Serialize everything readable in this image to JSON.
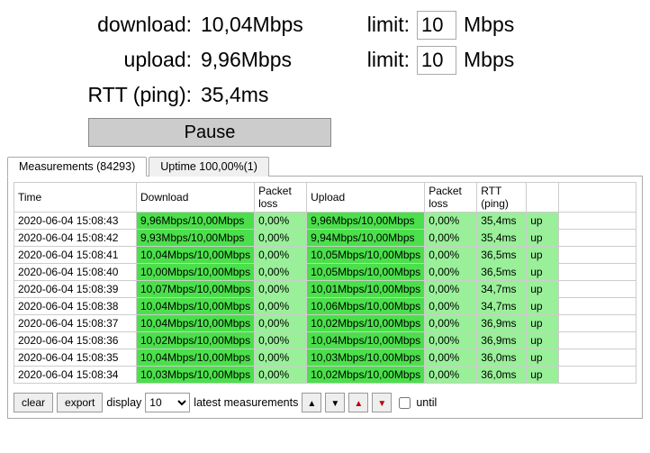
{
  "stats": {
    "download_label": "download:",
    "download_value": "10,04Mbps",
    "upload_label": "upload:",
    "upload_value": "9,96Mbps",
    "rtt_label": "RTT (ping):",
    "rtt_value": "35,4ms",
    "limit_label": "limit:",
    "limit_download_value": "10",
    "limit_upload_value": "10",
    "limit_unit": "Mbps"
  },
  "pause_label": "Pause",
  "tabs": {
    "measurements": "Measurements  (84293)",
    "uptime": "Uptime  100,00%(1)"
  },
  "columns": {
    "time": "Time",
    "download": "Download",
    "packet_loss": "Packet loss",
    "upload": "Upload",
    "packet_loss2": "Packet loss",
    "rtt": "RTT (ping)",
    "status": ""
  },
  "rows": [
    {
      "time": "2020-06-04 15:08:43",
      "dl": "9,96Mbps/10,00Mbps",
      "pl": "0,00%",
      "ul": "9,96Mbps/10,00Mbps",
      "pl2": "0,00%",
      "rtt": "35,4ms",
      "st": "up"
    },
    {
      "time": "2020-06-04 15:08:42",
      "dl": "9,93Mbps/10,00Mbps",
      "pl": "0,00%",
      "ul": "9,94Mbps/10,00Mbps",
      "pl2": "0,00%",
      "rtt": "35,4ms",
      "st": "up"
    },
    {
      "time": "2020-06-04 15:08:41",
      "dl": "10,04Mbps/10,00Mbps",
      "pl": "0,00%",
      "ul": "10,05Mbps/10,00Mbps",
      "pl2": "0,00%",
      "rtt": "36,5ms",
      "st": "up"
    },
    {
      "time": "2020-06-04 15:08:40",
      "dl": "10,00Mbps/10,00Mbps",
      "pl": "0,00%",
      "ul": "10,05Mbps/10,00Mbps",
      "pl2": "0,00%",
      "rtt": "36,5ms",
      "st": "up"
    },
    {
      "time": "2020-06-04 15:08:39",
      "dl": "10,07Mbps/10,00Mbps",
      "pl": "0,00%",
      "ul": "10,01Mbps/10,00Mbps",
      "pl2": "0,00%",
      "rtt": "34,7ms",
      "st": "up"
    },
    {
      "time": "2020-06-04 15:08:38",
      "dl": "10,04Mbps/10,00Mbps",
      "pl": "0,00%",
      "ul": "10,06Mbps/10,00Mbps",
      "pl2": "0,00%",
      "rtt": "34,7ms",
      "st": "up"
    },
    {
      "time": "2020-06-04 15:08:37",
      "dl": "10,04Mbps/10,00Mbps",
      "pl": "0,00%",
      "ul": "10,02Mbps/10,00Mbps",
      "pl2": "0,00%",
      "rtt": "36,9ms",
      "st": "up"
    },
    {
      "time": "2020-06-04 15:08:36",
      "dl": "10,02Mbps/10,00Mbps",
      "pl": "0,00%",
      "ul": "10,04Mbps/10,00Mbps",
      "pl2": "0,00%",
      "rtt": "36,9ms",
      "st": "up"
    },
    {
      "time": "2020-06-04 15:08:35",
      "dl": "10,04Mbps/10,00Mbps",
      "pl": "0,00%",
      "ul": "10,03Mbps/10,00Mbps",
      "pl2": "0,00%",
      "rtt": "36,0ms",
      "st": "up"
    },
    {
      "time": "2020-06-04 15:08:34",
      "dl": "10,03Mbps/10,00Mbps",
      "pl": "0,00%",
      "ul": "10,02Mbps/10,00Mbps",
      "pl2": "0,00%",
      "rtt": "36,0ms",
      "st": "up"
    }
  ],
  "footer": {
    "clear": "clear",
    "export": "export",
    "display": "display",
    "display_value": "10",
    "latest": "latest measurements",
    "until": "until"
  }
}
